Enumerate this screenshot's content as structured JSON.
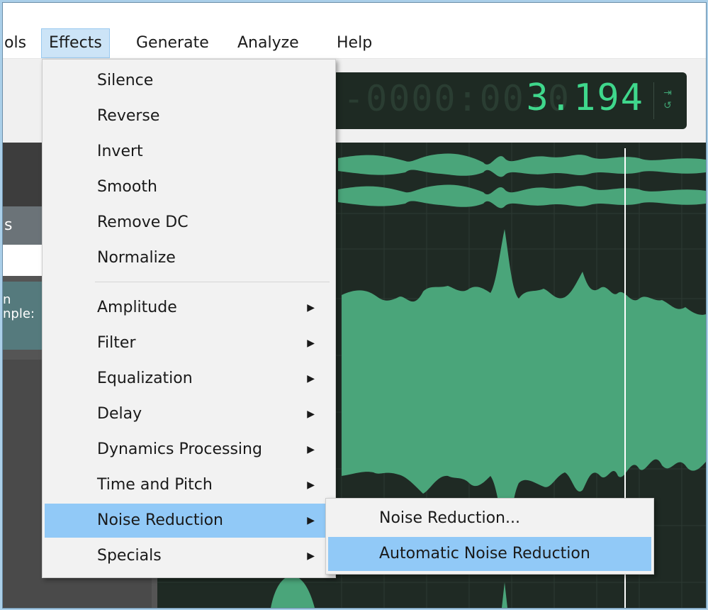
{
  "menubar": {
    "items": [
      {
        "label": "ols"
      },
      {
        "label": "Effects"
      },
      {
        "label": "Generate"
      },
      {
        "label": "Analyze"
      },
      {
        "label": "Help"
      }
    ]
  },
  "timer": {
    "ghost": "-0000:00.0",
    "value": "3.194"
  },
  "leftpanel": {
    "label": "s",
    "track_name_line1": "n",
    "track_name_line2": "nple:"
  },
  "effects_menu": {
    "items": [
      {
        "label": "Silence"
      },
      {
        "label": "Reverse"
      },
      {
        "label": "Invert"
      },
      {
        "label": "Smooth"
      },
      {
        "label": "Remove DC"
      },
      {
        "label": "Normalize"
      },
      {
        "label": "Amplitude"
      },
      {
        "label": "Filter"
      },
      {
        "label": "Equalization"
      },
      {
        "label": "Delay"
      },
      {
        "label": "Dynamics Processing"
      },
      {
        "label": "Time and Pitch"
      },
      {
        "label": "Noise Reduction"
      },
      {
        "label": "Specials"
      }
    ]
  },
  "noise_submenu": {
    "items": [
      {
        "label": "Noise Reduction..."
      },
      {
        "label": "Automatic Noise Reduction"
      }
    ]
  },
  "colors": {
    "waveform": "#4aa57a",
    "waveform_bg": "#1f2a24",
    "highlight": "#91c9f7"
  }
}
